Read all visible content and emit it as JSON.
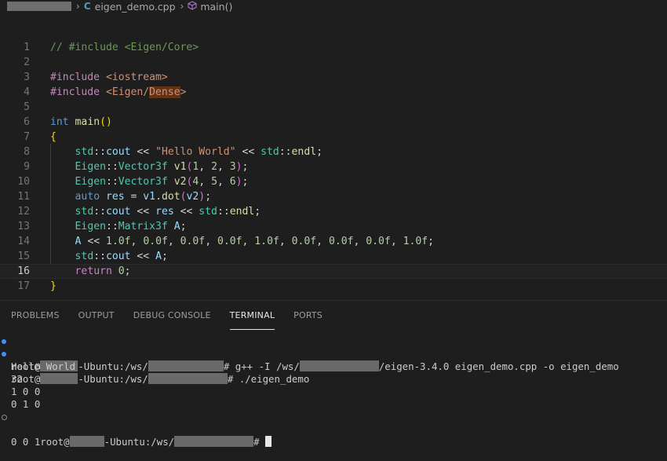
{
  "breadcrumb": {
    "file_icon": "C",
    "file": "eigen_demo.cpp",
    "function": "main()"
  },
  "editor": {
    "current_line": "16",
    "lines": [
      {
        "n": "1"
      },
      {
        "n": "2"
      },
      {
        "n": "3"
      },
      {
        "n": "4"
      },
      {
        "n": "5"
      },
      {
        "n": "6"
      },
      {
        "n": "7"
      },
      {
        "n": "8"
      },
      {
        "n": "9"
      },
      {
        "n": "10"
      },
      {
        "n": "11"
      },
      {
        "n": "12"
      },
      {
        "n": "13"
      },
      {
        "n": "14"
      },
      {
        "n": "15"
      },
      {
        "n": "16"
      },
      {
        "n": "17"
      }
    ]
  },
  "panel": {
    "tabs": [
      "PROBLEMS",
      "OUTPUT",
      "DEBUG CONSOLE",
      "TERMINAL",
      "PORTS"
    ],
    "active_tab": "TERMINAL"
  },
  "terminal": {
    "l1": {
      "a": "root@",
      "b": "-Ubuntu:/ws/",
      "c": "# g++ -I /ws/",
      "d": "/eigen-3.4.0 eigen_demo.cpp -o eigen_demo"
    },
    "l2": {
      "a": "root@",
      "b": "-Ubuntu:/ws/",
      "c": "# ./eigen_demo"
    },
    "l3": "Hello World",
    "l4": "32",
    "l5": "1 0 0",
    "l6": "0 1 0",
    "l7": {
      "a": "0 0 1root@",
      "b": "-Ubuntu:/ws/",
      "c": "# "
    }
  },
  "colors": {
    "background": "#1e1e1e",
    "comment": "#6a9955",
    "keyword": "#569cd6",
    "type": "#4ec9b0",
    "string": "#ce9178",
    "number": "#b5cea8",
    "terminal_dot": "#3794ff"
  },
  "icons": {
    "file": "cpp-file-icon",
    "function": "method-cube-icon",
    "chevron": "chevron-right-icon"
  }
}
